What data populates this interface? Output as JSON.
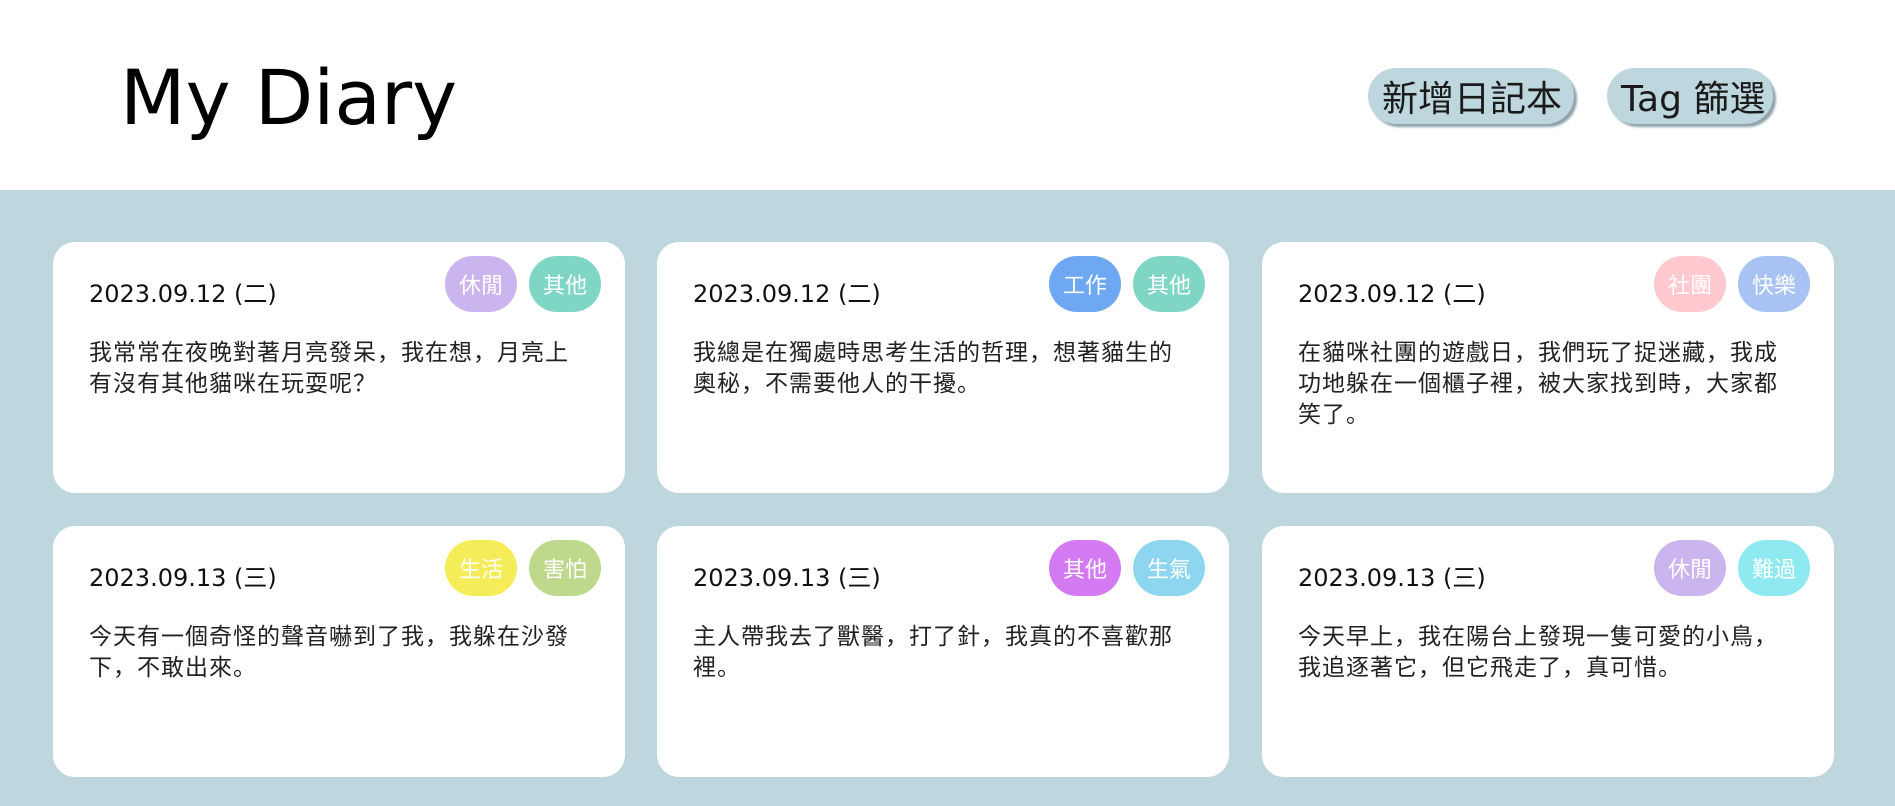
{
  "app": {
    "title": "My Diary"
  },
  "header": {
    "new_diary_label": "新增日記本",
    "tag_filter_label": "Tag 篩選",
    "button_color": "#bed6de"
  },
  "colors": {
    "background": "#bed6de",
    "card": "#ffffff"
  },
  "entries": [
    {
      "date": "2023.09.12 (二)",
      "tags": [
        {
          "label": "休閒",
          "color": "#cbb5ee"
        },
        {
          "label": "其他",
          "color": "#80d6c4"
        }
      ],
      "text": "我常常在夜晚對著月亮發呆，我在想，月亮上有沒有其他貓咪在玩耍呢？"
    },
    {
      "date": "2023.09.12 (二)",
      "tags": [
        {
          "label": "工作",
          "color": "#6fa8f2"
        },
        {
          "label": "其他",
          "color": "#80d6c4"
        }
      ],
      "text": "我總是在獨處時思考生活的哲理，想著貓生的奧秘，不需要他人的干擾。"
    },
    {
      "date": "2023.09.12 (二)",
      "tags": [
        {
          "label": "社團",
          "color": "#ffc9cf"
        },
        {
          "label": "快樂",
          "color": "#a8c3f3"
        }
      ],
      "text": "在貓咪社團的遊戲日，我們玩了捉迷藏，我成功地躲在一個櫃子裡，被大家找到時，大家都笑了。"
    },
    {
      "date": "2023.09.13 (三)",
      "tags": [
        {
          "label": "生活",
          "color": "#f5ec5a"
        },
        {
          "label": "害怕",
          "color": "#bfd98c"
        }
      ],
      "text": "今天有一個奇怪的聲音嚇到了我，我躲在沙發下，不敢出來。"
    },
    {
      "date": "2023.09.13 (三)",
      "tags": [
        {
          "label": "其他",
          "color": "#d47af2"
        },
        {
          "label": "生氣",
          "color": "#8ed6f0"
        }
      ],
      "text": "主人帶我去了獸醫，打了針，我真的不喜歡那裡。"
    },
    {
      "date": "2023.09.13 (三)",
      "tags": [
        {
          "label": "休閒",
          "color": "#cbb5ee"
        },
        {
          "label": "難過",
          "color": "#8eeaf0"
        }
      ],
      "text": "今天早上，我在陽台上發現一隻可愛的小鳥，我追逐著它，但它飛走了，真可惜。"
    }
  ]
}
